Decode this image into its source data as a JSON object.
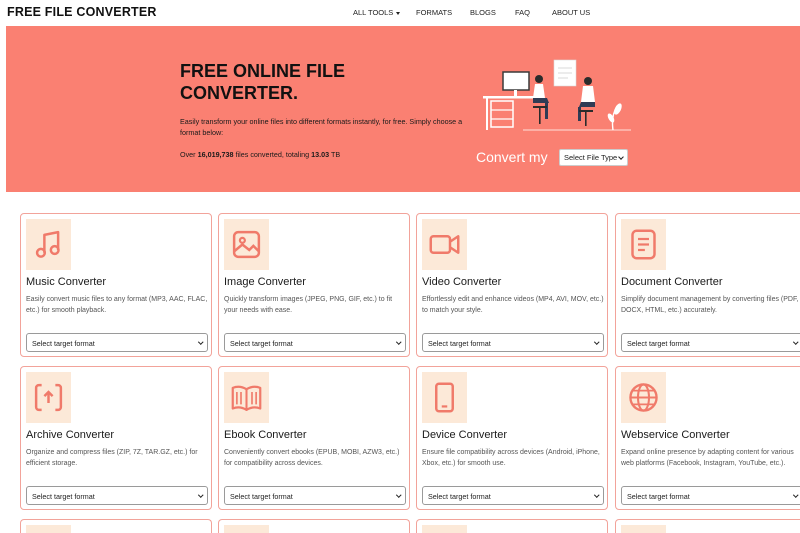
{
  "nav": {
    "brand": "FREE FILE CONVERTER",
    "items": [
      {
        "label": "ALL TOOLS",
        "dropdown": true
      },
      {
        "label": "FORMATS",
        "dropdown": false
      },
      {
        "label": "BLOGS",
        "dropdown": false
      },
      {
        "label": "FAQ",
        "dropdown": false
      },
      {
        "label": "ABOUT US",
        "dropdown": false
      }
    ]
  },
  "hero": {
    "title": "FREE ONLINE FILE CONVERTER.",
    "description": "Easily transform your online files into different formats instantly, for free. Simply choose a format below:",
    "stats_prefix": "Over",
    "files_converted": "16,019,738",
    "stats_middle": "files converted, totaling",
    "total_size": "13.03",
    "size_unit": "TB",
    "convert_label": "Convert my",
    "file_type_select": "Select File Type"
  },
  "colors": {
    "hero_bg": "#fa8072",
    "accent": "#f07a6a",
    "icon_bg": "#fce9d8",
    "card_border": "#f2a39a"
  },
  "converters": [
    {
      "title": "Music Converter",
      "icon": "music-note-icon",
      "description": "Easily convert music files to any format (MP3, AAC, FLAC, etc.) for smooth playback.",
      "select": "Select target format"
    },
    {
      "title": "Image Converter",
      "icon": "image-icon",
      "description": "Quickly transform images (JPEG, PNG, GIF, etc.) to fit your needs with ease.",
      "select": "Select target format"
    },
    {
      "title": "Video Converter",
      "icon": "video-camera-icon",
      "description": "Effortlessly edit and enhance videos (MP4, AVI, MOV, etc.) to match your style.",
      "select": "Select target format"
    },
    {
      "title": "Document Converter",
      "icon": "document-icon",
      "description": "Simplify document management by converting files (PDF, DOCX, HTML, etc.) accurately.",
      "select": "Select target format"
    },
    {
      "title": "Archive Converter",
      "icon": "archive-icon",
      "description": "Organize and compress files (ZIP, 7Z, TAR.GZ, etc.) for efficient storage.",
      "select": "Select target format"
    },
    {
      "title": "Ebook Converter",
      "icon": "book-icon",
      "description": "Conveniently convert ebooks (EPUB, MOBI, AZW3, etc.) for compatibility across devices.",
      "select": "Select target format"
    },
    {
      "title": "Device Converter",
      "icon": "smartphone-icon",
      "description": "Ensure file compatibility across devices (Android, iPhone, Xbox, etc.) for smooth use.",
      "select": "Select target format"
    },
    {
      "title": "Webservice Converter",
      "icon": "globe-icon",
      "description": "Expand online presence by adapting content for various web platforms (Facebook, Instagram, YouTube, etc.).",
      "select": "Select target format"
    }
  ]
}
